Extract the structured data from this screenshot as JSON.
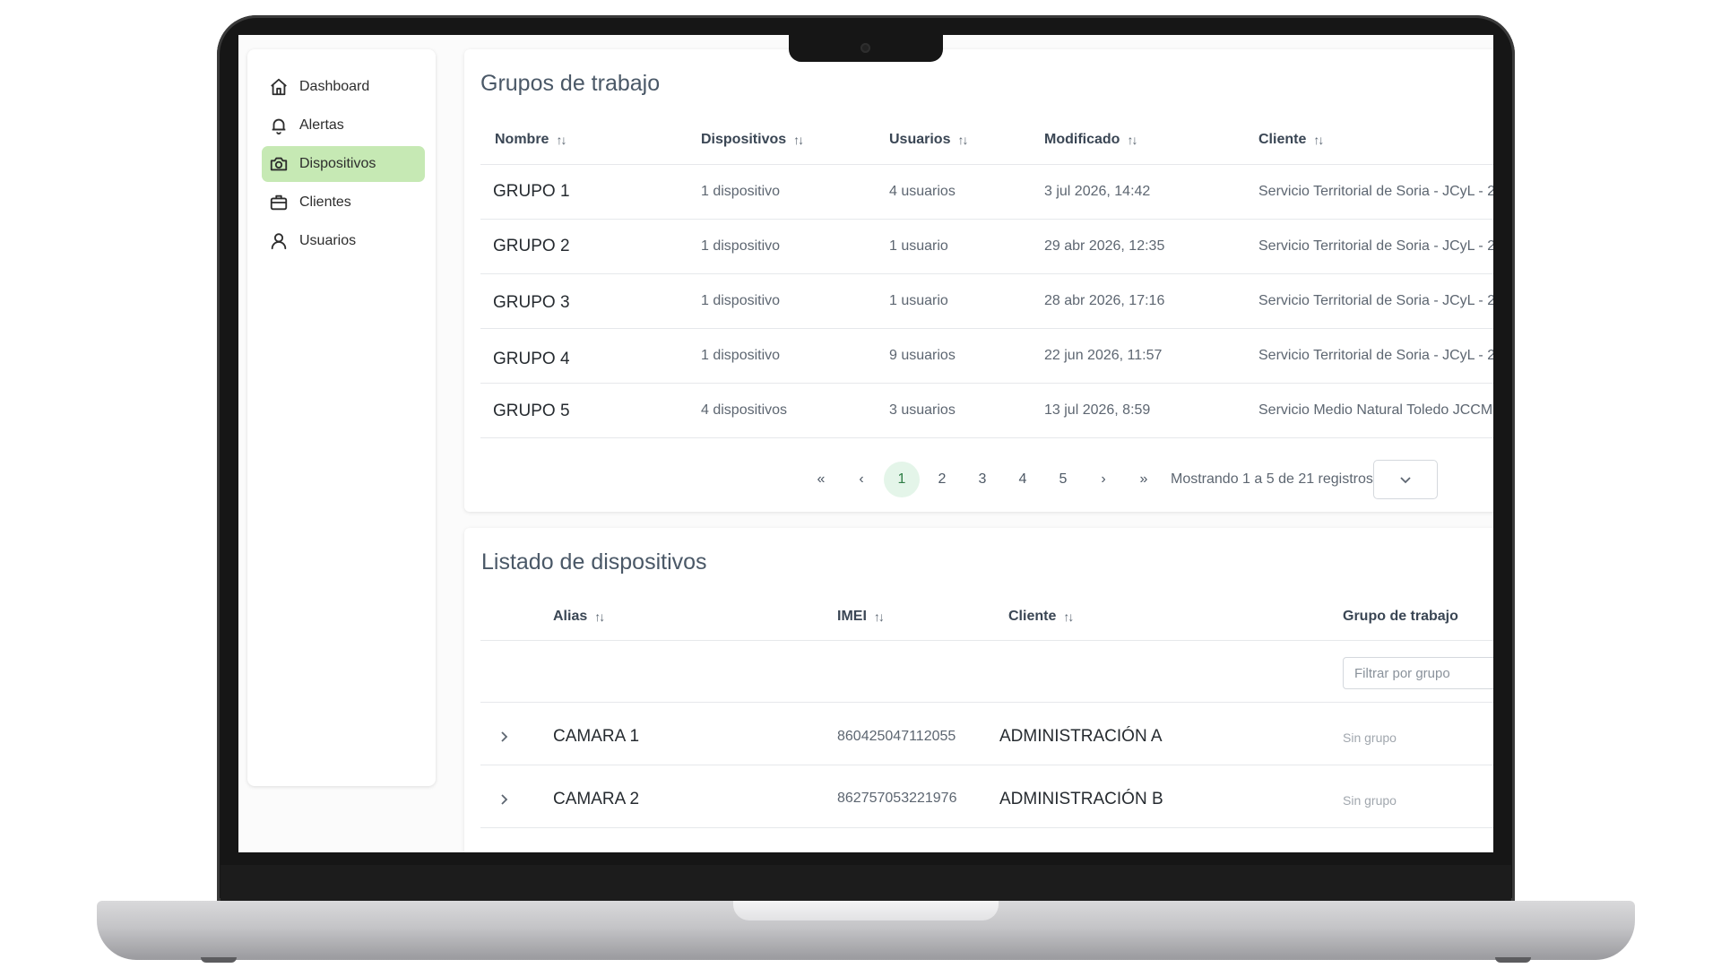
{
  "sidebar": {
    "items": [
      {
        "label": "Dashboard",
        "icon": "home-icon",
        "active": false
      },
      {
        "label": "Alertas",
        "icon": "bell-icon",
        "active": false
      },
      {
        "label": "Dispositivos",
        "icon": "camera-icon",
        "active": true
      },
      {
        "label": "Clientes",
        "icon": "briefcase-icon",
        "active": false
      },
      {
        "label": "Usuarios",
        "icon": "user-icon",
        "active": false
      }
    ]
  },
  "groups": {
    "title": "Grupos de trabajo",
    "columns": [
      "Nombre",
      "Dispositivos",
      "Usuarios",
      "Modificado",
      "Cliente"
    ],
    "sort_glyph": "↑↓",
    "rows": [
      {
        "name": "GRUPO 1",
        "devices": "1 dispositivo",
        "users": "4 usuarios",
        "modified": "3 jul 2026, 14:42",
        "client": "Servicio Territorial de Soria - JCyL - 2"
      },
      {
        "name": "GRUPO 2",
        "devices": "1 dispositivo",
        "users": "1 usuario",
        "modified": "29 abr 2026, 12:35",
        "client": "Servicio Territorial de Soria - JCyL - 2"
      },
      {
        "name": "GRUPO 3",
        "devices": "1 dispositivo",
        "users": "1 usuario",
        "modified": "28 abr 2026, 17:16",
        "client": "Servicio Territorial de Soria - JCyL - 2"
      },
      {
        "name": "GRUPO 4",
        "devices": "1 dispositivo",
        "users": "9 usuarios",
        "modified": "22 jun 2026, 11:57",
        "client": "Servicio Territorial de Soria - JCyL - 2"
      },
      {
        "name": "GRUPO 5",
        "devices": "4 dispositivos",
        "users": "3 usuarios",
        "modified": "13 jul 2026, 8:59",
        "client": "Servicio Medio Natural Toledo JCCM"
      }
    ],
    "pagination": {
      "first": "«",
      "prev": "‹",
      "pages": [
        "1",
        "2",
        "3",
        "4",
        "5"
      ],
      "current": "1",
      "next": "›",
      "last": "»",
      "summary": "Mostrando 1 a 5 de 21 registros"
    }
  },
  "devices": {
    "title": "Listado de dispositivos",
    "columns": [
      "Alias",
      "IMEI",
      "Cliente",
      "Grupo de trabajo"
    ],
    "sort_glyph": "↑↓",
    "filter_placeholder": "Filtrar por grupo",
    "rows": [
      {
        "alias": "CAMARA 1",
        "imei": "860425047112055",
        "client": "ADMINISTRACIÓN A",
        "group": "Sin grupo"
      },
      {
        "alias": "CAMARA 2",
        "imei": "862757053221976",
        "client": "ADMINISTRACIÓN B",
        "group": "Sin grupo"
      }
    ]
  },
  "colors": {
    "active_nav": "#c6e9b4",
    "current_page": "#e4f5e9",
    "heading": "#4a5867"
  }
}
